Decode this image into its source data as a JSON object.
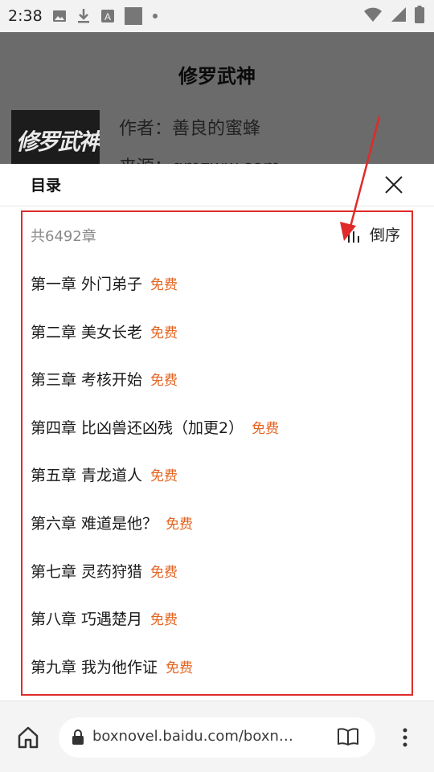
{
  "status_bar": {
    "time": "2:38"
  },
  "book": {
    "title": "修罗武神",
    "cover_text": "修罗武神",
    "author": "作者：善良的蜜蜂",
    "source": "来源：qmzww.com"
  },
  "toc": {
    "title": "目录",
    "count": "共6492章",
    "sort_label": "倒序",
    "chapters": [
      {
        "name": "第一章 外门弟子",
        "badge": "免费"
      },
      {
        "name": "第二章 美女长老",
        "badge": "免费"
      },
      {
        "name": "第三章 考核开始",
        "badge": "免费"
      },
      {
        "name": "第四章 比凶兽还凶残（加更2）",
        "badge": "免费"
      },
      {
        "name": "第五章 青龙道人",
        "badge": "免费"
      },
      {
        "name": "第六章 难道是他？",
        "badge": "免费"
      },
      {
        "name": "第七章 灵药狩猎",
        "badge": "免费"
      },
      {
        "name": "第八章 巧遇楚月",
        "badge": "免费"
      },
      {
        "name": "第九章 我为他作证",
        "badge": "免费"
      }
    ]
  },
  "browser": {
    "url": "boxnovel.baidu.com/boxn…"
  },
  "colors": {
    "free_badge": "#e4631f",
    "annotation": "#e02a2a",
    "backdrop": "#6b6b6b"
  }
}
